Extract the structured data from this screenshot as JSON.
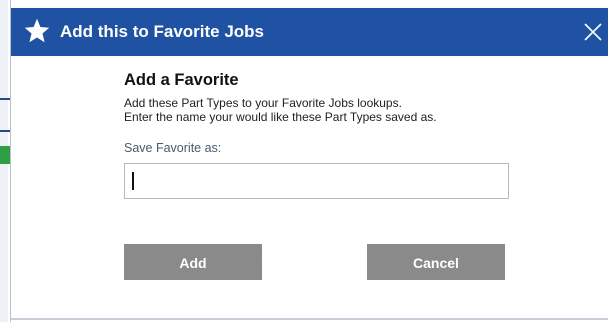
{
  "dialog": {
    "header_title": "Add this to Favorite Jobs",
    "heading": "Add a Favorite",
    "description_line1": "Add these Part Types to your Favorite Jobs lookups.",
    "description_line2": "Enter the name your would like these Part Types saved as.",
    "field_label": "Save Favorite as:",
    "field_value": "",
    "add_label": "Add",
    "cancel_label": "Cancel"
  },
  "icons": {
    "header": "star-icon",
    "close": "close-icon"
  },
  "colors": {
    "header_bg": "#1f52a3",
    "button_bg": "#8a8a8a",
    "header_text": "#ffffff"
  }
}
